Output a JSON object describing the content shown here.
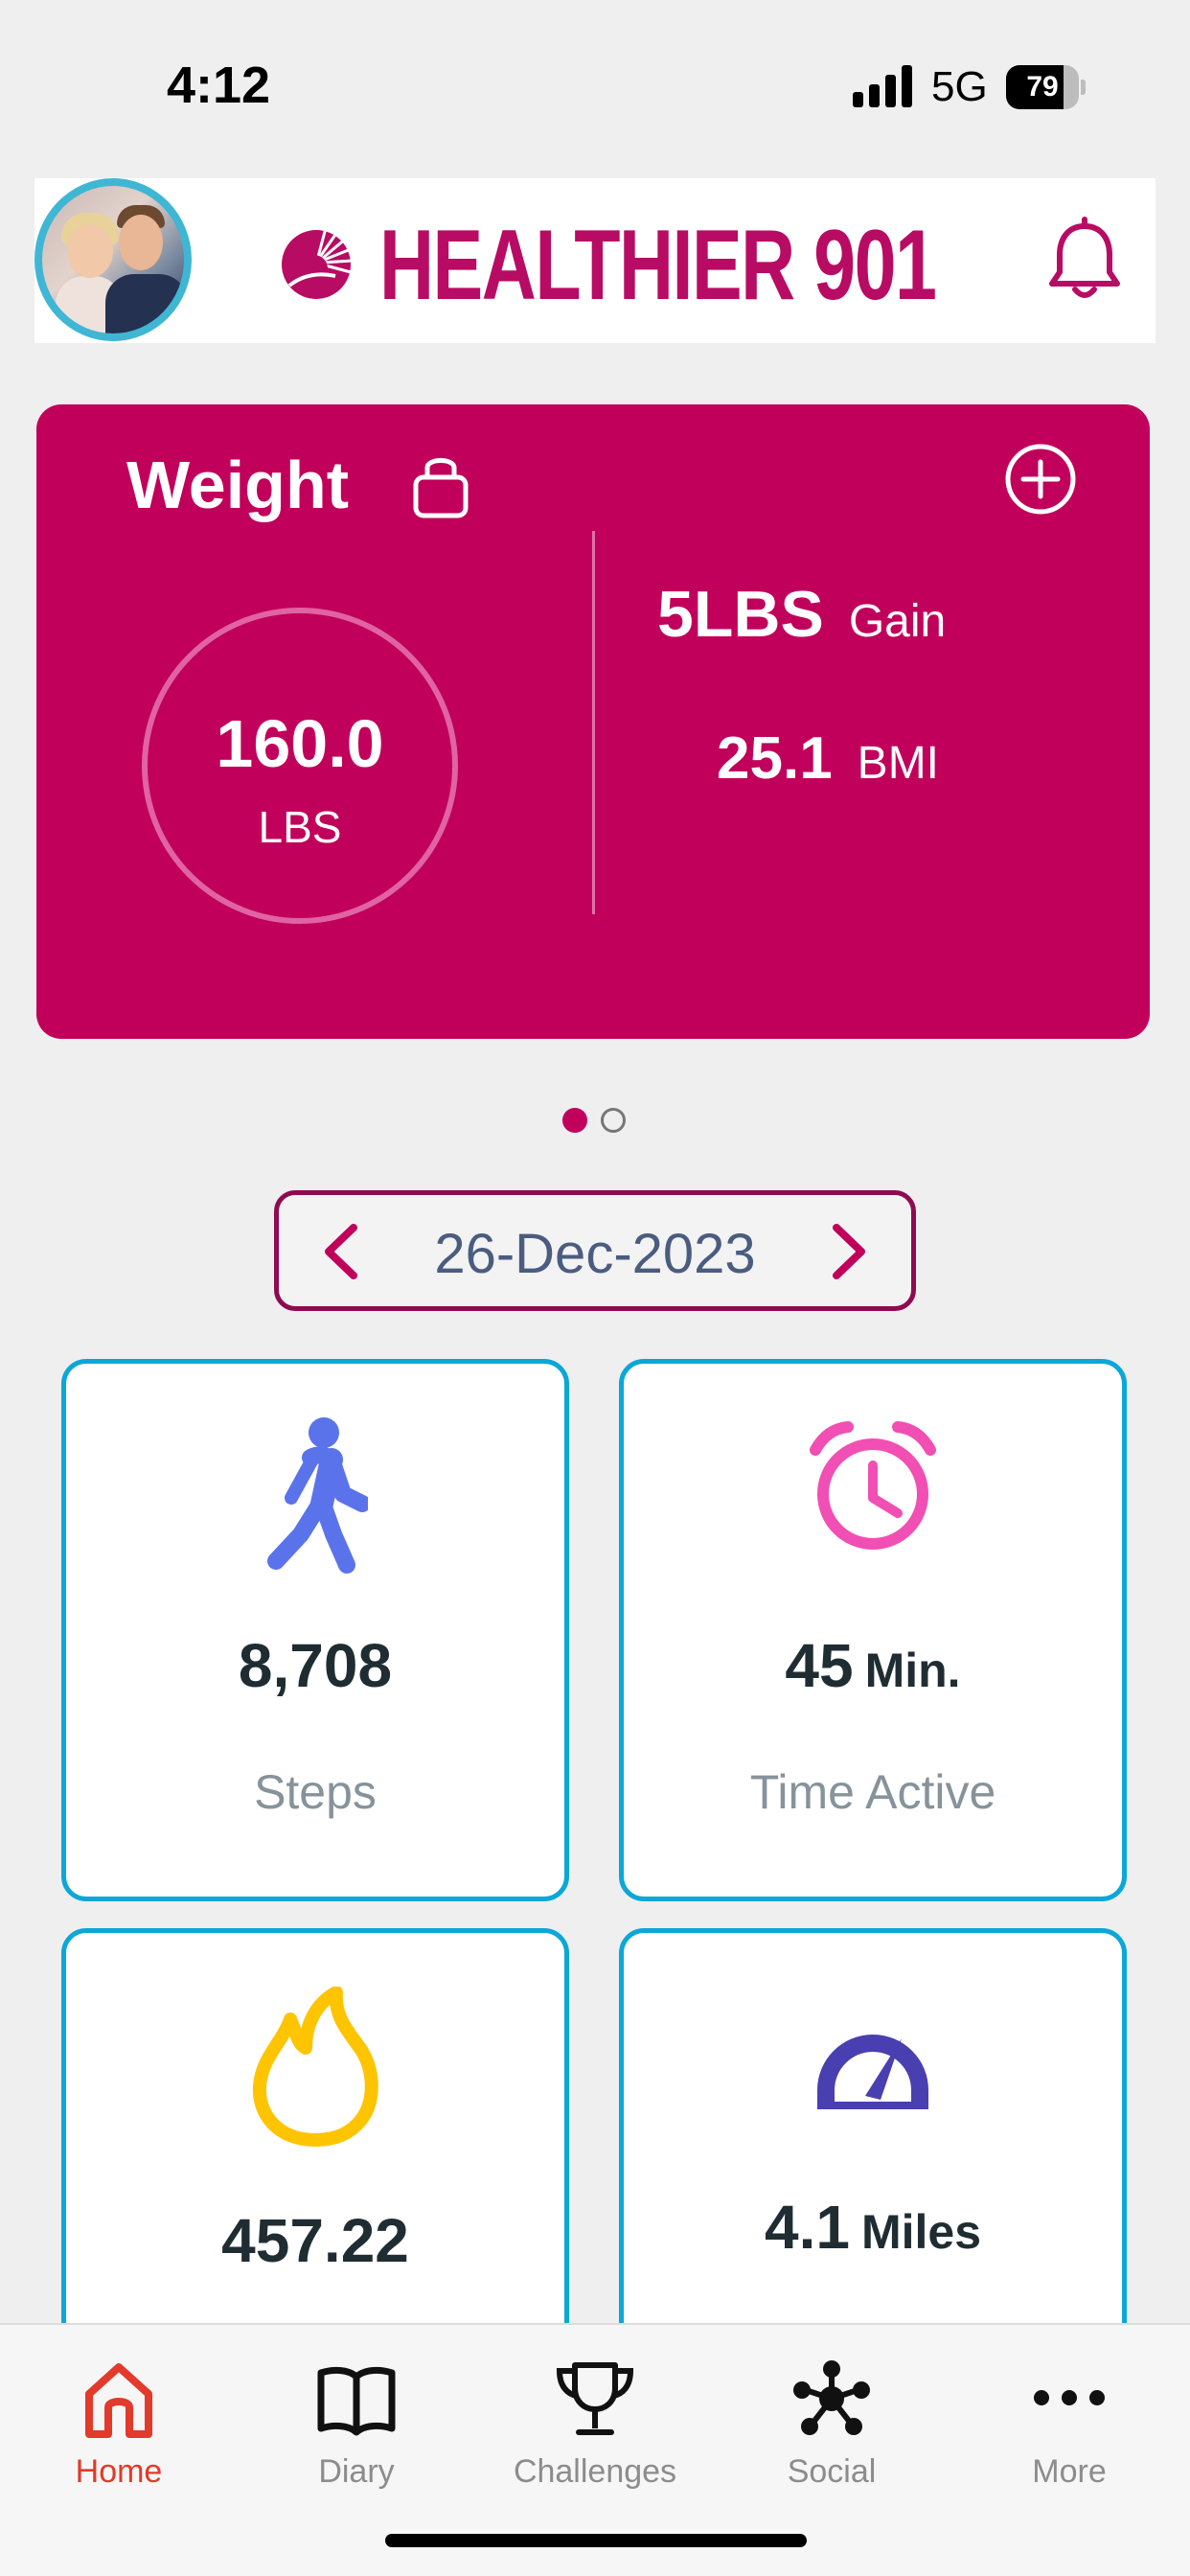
{
  "status_bar": {
    "time": "4:12",
    "network": "5G",
    "battery_level": "79",
    "battery_fraction": 0.79
  },
  "header": {
    "brand_name": "HEALTHIER 901",
    "brand_color": "#b80b63",
    "avatar_icon": "user-avatar-photo",
    "notification_icon": "bell-icon"
  },
  "weight_card": {
    "title": "Weight",
    "lock_icon": "lock-icon",
    "add_icon": "plus-circle-icon",
    "weight_value": "160.0",
    "weight_unit": "LBS",
    "change_value": "5LBS",
    "change_label": "Gain",
    "bmi_value": "25.1",
    "bmi_label": "BMI",
    "card_color": "#c1005b"
  },
  "pager": {
    "total": 2,
    "active_index": 0
  },
  "date_selector": {
    "date": "26-Dec-2023",
    "prev_icon": "chevron-left-icon",
    "next_icon": "chevron-right-icon"
  },
  "tiles": [
    {
      "icon": "walking-person-icon",
      "value": "8,708",
      "unit": "",
      "label": "Steps",
      "icon_color": "#5b73ea"
    },
    {
      "icon": "alarm-clock-icon",
      "value": "45",
      "unit": "Min.",
      "label": "Time Active",
      "icon_color": "#f14fb3"
    },
    {
      "icon": "flame-icon",
      "value": "457.22",
      "unit": "",
      "label": "",
      "icon_color": "#ffc400"
    },
    {
      "icon": "speedometer-icon",
      "value": "4.1",
      "unit": "Miles",
      "label": "",
      "icon_color": "#4a3fb0"
    }
  ],
  "tab_bar": {
    "active": "Home",
    "active_color": "#e23a2b",
    "items": [
      {
        "label": "Home",
        "icon": "home-icon"
      },
      {
        "label": "Diary",
        "icon": "book-icon"
      },
      {
        "label": "Challenges",
        "icon": "trophy-icon"
      },
      {
        "label": "Social",
        "icon": "network-icon"
      },
      {
        "label": "More",
        "icon": "more-dots-icon"
      }
    ]
  }
}
